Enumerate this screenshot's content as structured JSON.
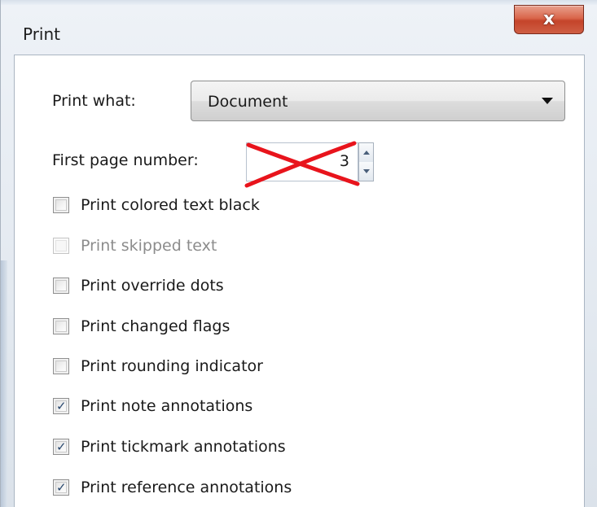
{
  "window": {
    "title": "Print",
    "close_glyph": "x"
  },
  "print_what": {
    "label": "Print what:",
    "selected": "Document"
  },
  "first_page": {
    "label": "First page number:",
    "value": "3"
  },
  "options": [
    {
      "label": "Print colored text black",
      "checked": false,
      "enabled": true
    },
    {
      "label": "Print skipped text",
      "checked": false,
      "enabled": false
    },
    {
      "label": "Print override dots",
      "checked": false,
      "enabled": true
    },
    {
      "label": "Print changed flags",
      "checked": false,
      "enabled": true
    },
    {
      "label": "Print rounding indicator",
      "checked": false,
      "enabled": true
    },
    {
      "label": "Print note annotations",
      "checked": true,
      "enabled": true
    },
    {
      "label": "Print tickmark annotations",
      "checked": true,
      "enabled": true
    },
    {
      "label": "Print reference annotations",
      "checked": true,
      "enabled": true
    }
  ],
  "colors": {
    "annotation_red": "#e8141c",
    "check_blue": "#27466d",
    "close_red": "#c4442a"
  }
}
